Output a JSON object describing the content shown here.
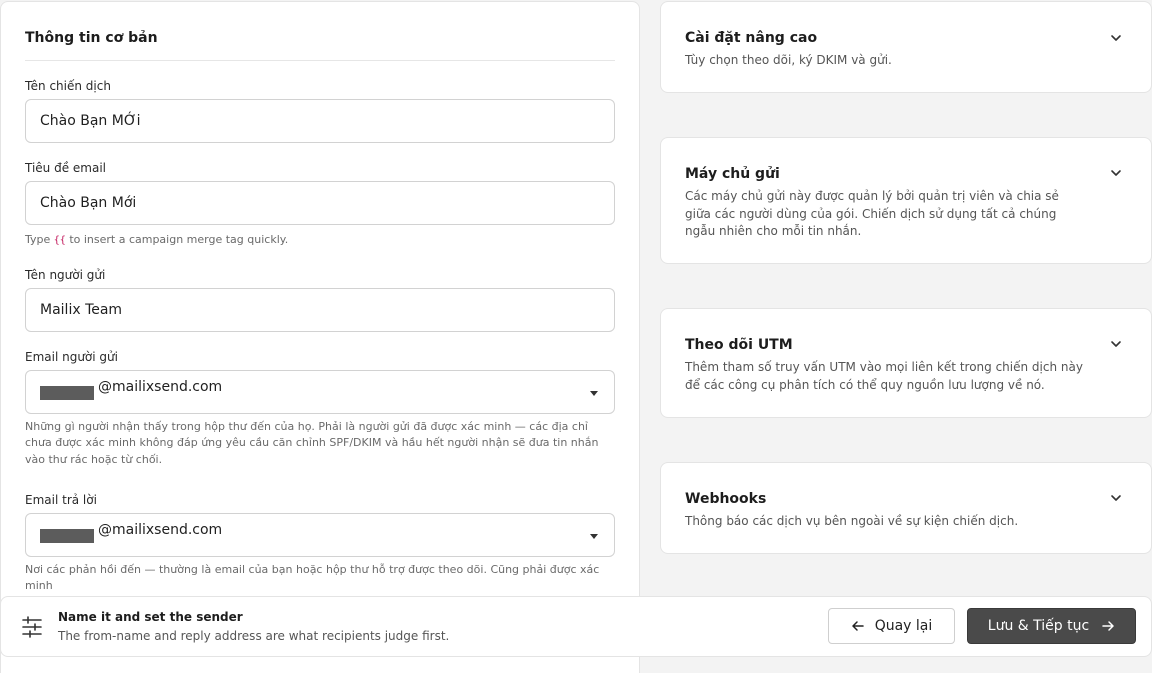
{
  "basic_info": {
    "title": "Thông tin cơ bản",
    "campaign_name": {
      "label": "Tên chiến dịch",
      "value": "Chào Bạn MỚi"
    },
    "email_subject": {
      "label": "Tiêu đề email",
      "value": "Chào Bạn Mới",
      "help_prefix": "Type",
      "help_tag": "{{",
      "help_suffix": "to insert a campaign merge tag quickly."
    },
    "sender_name": {
      "label": "Tên người gửi",
      "value": "Mailix Team"
    },
    "sender_email": {
      "label": "Email người gửi",
      "domain": "@mailixsend.com",
      "help": "Những gì người nhận thấy trong hộp thư đến của họ. Phải là người gửi đã được xác minh — các địa chỉ chưa được xác minh không đáp ứng yêu cầu căn chỉnh SPF/DKIM và hầu hết người nhận sẽ đưa tin nhắn vào thư rác hoặc từ chối."
    },
    "reply_email": {
      "label": "Email trả lời",
      "domain": "@mailixsend.com",
      "help": "Nơi các phản hồi đến — thường là email của bạn hoặc hộp thư hỗ trợ được theo dõi. Cũng phải được xác minh"
    }
  },
  "accordions": [
    {
      "title": "Cài đặt nâng cao",
      "desc": "Tùy chọn theo dõi, ký DKIM và gửi."
    },
    {
      "title": "Máy chủ gửi",
      "desc": "Các máy chủ gửi này được quản lý bởi quản trị viên và chia sẻ giữa các người dùng của gói. Chiến dịch sử dụng tất cả chúng ngẫu nhiên cho mỗi tin nhắn."
    },
    {
      "title": "Theo dõi UTM",
      "desc": "Thêm tham số truy vấn UTM vào mọi liên kết trong chiến dịch này để các công cụ phân tích có thể quy nguồn lưu lượng về nó."
    },
    {
      "title": "Webhooks",
      "desc": "Thông báo các dịch vụ bên ngoài về sự kiện chiến dịch."
    }
  ],
  "footer": {
    "icon": "sliders-icon",
    "title": "Name it and set the sender",
    "subtitle": "The from-name and reply address are what recipients judge first.",
    "back_label": "Quay lại",
    "next_label": "Lưu & Tiếp tục"
  }
}
